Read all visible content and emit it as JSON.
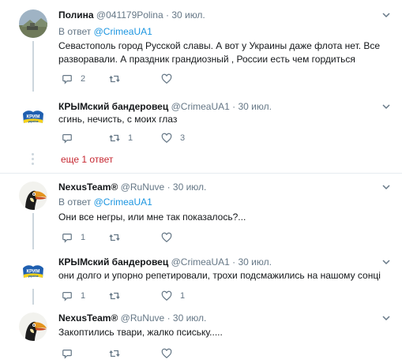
{
  "tweets": [
    {
      "name": "Полина",
      "handle": "@041179Polina",
      "separator": "·",
      "date": "30 июл.",
      "reply_prefix": "В ответ",
      "reply_mention": "@CrimeaUA1",
      "text": "Севастополь город Русской славы. А вот у Украины даже флота нет. Все разворавали. А праздник грандиозный , России есть чем гордиться",
      "replies": "2",
      "retweets": "",
      "likes": ""
    },
    {
      "name": "КРЫМский бандеровец",
      "handle": "@CrimeaUA1",
      "separator": "·",
      "date": "30 июл.",
      "text": "сгинь, нечисть, с моих глаз",
      "replies": "",
      "retweets": "1",
      "likes": "3"
    },
    {
      "name": "NexusTeam®",
      "handle": "@RuNuve",
      "separator": "·",
      "date": "30 июл.",
      "reply_prefix": "В ответ",
      "reply_mention": "@CrimeaUA1",
      "text": "Они все негры, или мне так показалось?...",
      "replies": "1",
      "retweets": "",
      "likes": ""
    },
    {
      "name": "КРЫМский бандеровец",
      "handle": "@CrimeaUA1",
      "separator": "·",
      "date": "30 июл.",
      "text": "они долго и упорно репетировали, трохи подсмажились на нашому сонці",
      "replies": "1",
      "retweets": "",
      "likes": "1"
    },
    {
      "name": "NexusTeam®",
      "handle": "@RuNuve",
      "separator": "·",
      "date": "30 июл.",
      "text": "Закоптились твари, жалко псиську.....",
      "replies": "",
      "retweets": "",
      "likes": ""
    }
  ],
  "show_more": "еще 1 ответ",
  "avatar_logo_text": "КРИМ",
  "avatar_logo_subtext": "україна",
  "colors": {
    "link": "#1b95e0",
    "more": "#c62832",
    "muted": "#657786",
    "thread": "#ccd6dd",
    "flag_blue": "#1f5fb0",
    "flag_yellow": "#f6d21b"
  },
  "icons": {
    "reply": "reply-icon",
    "retweet": "retweet-icon",
    "like": "heart-icon",
    "menu": "chevron-down-icon"
  }
}
